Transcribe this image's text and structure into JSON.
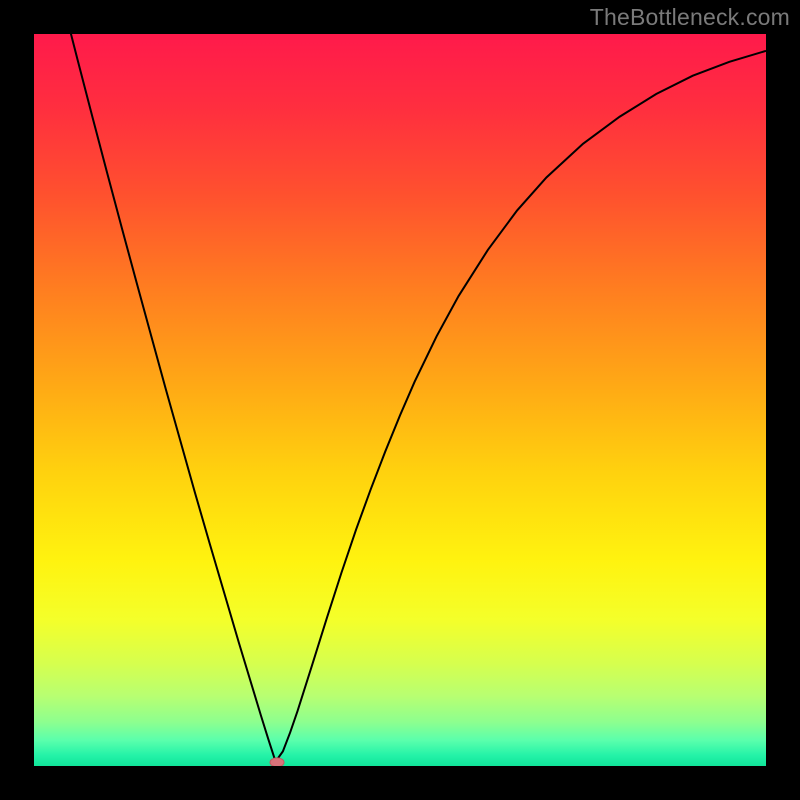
{
  "attribution": "TheBottleneck.com",
  "colors": {
    "black": "#000000",
    "curve": "#000000",
    "marker_fill": "#d9727a",
    "marker_stroke": "#c25a62",
    "gradient_stops": [
      {
        "offset": 0.0,
        "color": "#ff1a4b"
      },
      {
        "offset": 0.1,
        "color": "#ff2e3f"
      },
      {
        "offset": 0.22,
        "color": "#ff512e"
      },
      {
        "offset": 0.35,
        "color": "#ff7e20"
      },
      {
        "offset": 0.48,
        "color": "#ffa915"
      },
      {
        "offset": 0.6,
        "color": "#ffd20e"
      },
      {
        "offset": 0.72,
        "color": "#fff30f"
      },
      {
        "offset": 0.8,
        "color": "#f4ff2a"
      },
      {
        "offset": 0.86,
        "color": "#d6ff4e"
      },
      {
        "offset": 0.905,
        "color": "#b7ff72"
      },
      {
        "offset": 0.94,
        "color": "#8dff8f"
      },
      {
        "offset": 0.965,
        "color": "#5affac"
      },
      {
        "offset": 0.985,
        "color": "#25f3a8"
      },
      {
        "offset": 1.0,
        "color": "#10e59a"
      }
    ]
  },
  "chart_data": {
    "type": "line",
    "title": "",
    "xlabel": "",
    "ylabel": "",
    "xlim": [
      0,
      100
    ],
    "ylim": [
      0,
      100
    ],
    "grid": false,
    "legend": null,
    "annotations": [],
    "series": [
      {
        "name": "bottleneck-curve",
        "x": [
          2,
          4,
          6,
          8,
          10,
          12,
          14,
          16,
          18,
          20,
          22,
          24,
          26,
          28,
          30,
          31,
          32,
          33,
          34,
          35,
          36,
          38,
          40,
          42,
          44,
          46,
          48,
          50,
          52,
          55,
          58,
          62,
          66,
          70,
          75,
          80,
          85,
          90,
          95,
          100
        ],
        "y": [
          112,
          104.1,
          96.3,
          88.6,
          81.0,
          73.5,
          66.1,
          58.8,
          51.5,
          44.4,
          37.3,
          30.4,
          23.6,
          16.8,
          10.2,
          6.9,
          3.7,
          0.6,
          2.0,
          4.6,
          7.5,
          13.8,
          20.2,
          26.4,
          32.3,
          37.8,
          43.0,
          47.9,
          52.5,
          58.7,
          64.2,
          70.5,
          75.9,
          80.4,
          85.0,
          88.7,
          91.8,
          94.3,
          96.2,
          97.7
        ]
      }
    ],
    "marker": {
      "x": 33.2,
      "y": 0.5
    }
  }
}
